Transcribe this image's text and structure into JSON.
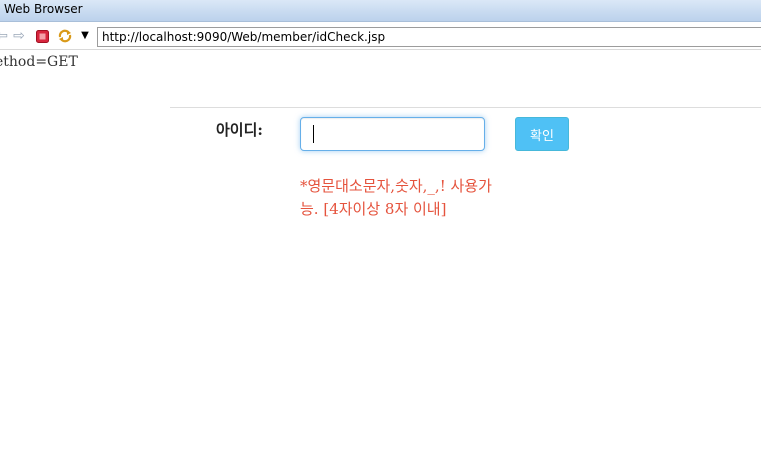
{
  "window": {
    "title": "Web Browser"
  },
  "toolbar": {
    "address": "http://localhost:9090/Web/member/idCheck.jsp",
    "icons": [
      "back-icon",
      "forward-icon",
      "stop-icon",
      "refresh-icon",
      "dropdown-icon"
    ]
  },
  "page": {
    "method_text": "ethod=GET",
    "id_label": "아이디:",
    "id_input_value": "",
    "confirm_label": "확인",
    "hint": "*영문대소문자,숫자,_,! 사용가능. [4자이상 8자 이내]",
    "colors": {
      "hint": "#e5533d",
      "button": "#4fc1f5",
      "input_focus": "#66afe9"
    }
  }
}
